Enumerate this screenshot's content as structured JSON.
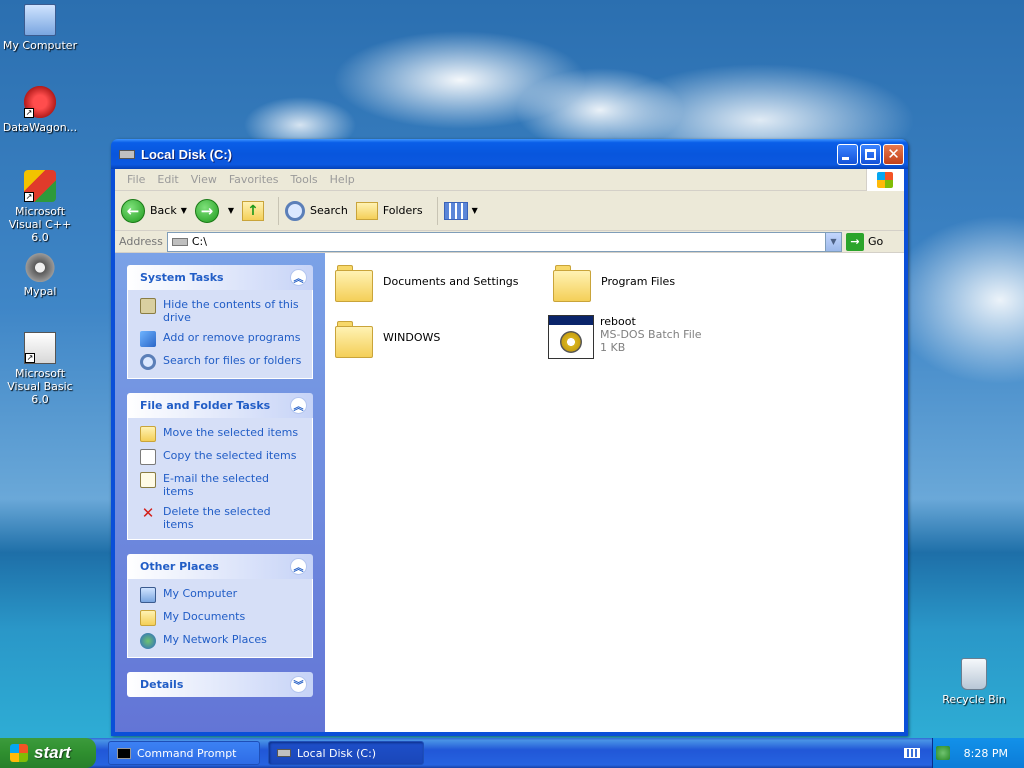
{
  "desktop": {
    "icons": [
      {
        "label": "My Computer"
      },
      {
        "label": "DataWagon..."
      },
      {
        "label": "Microsoft Visual C++ 6.0"
      },
      {
        "label": "Mypal"
      },
      {
        "label": "Microsoft Visual Basic 6.0"
      },
      {
        "label": "Recycle Bin"
      }
    ]
  },
  "window": {
    "title": "Local Disk (C:)",
    "menu": [
      "File",
      "Edit",
      "View",
      "Favorites",
      "Tools",
      "Help"
    ],
    "toolbar": {
      "back": "Back",
      "search": "Search",
      "folders": "Folders"
    },
    "address": {
      "label": "Address",
      "value": "C:\\",
      "go": "Go"
    }
  },
  "sidepane": {
    "system_tasks": {
      "title": "System Tasks",
      "items": [
        "Hide the contents of this drive",
        "Add or remove programs",
        "Search for files or folders"
      ]
    },
    "file_folder_tasks": {
      "title": "File and Folder Tasks",
      "items": [
        "Move the selected items",
        "Copy the selected items",
        "E-mail the selected items",
        "Delete the selected items"
      ]
    },
    "other_places": {
      "title": "Other Places",
      "items": [
        "My Computer",
        "My Documents",
        "My Network Places"
      ]
    },
    "details": {
      "title": "Details"
    }
  },
  "files": [
    {
      "name": "Documents and Settings"
    },
    {
      "name": "Program Files"
    },
    {
      "name": "WINDOWS"
    },
    {
      "name": "reboot",
      "type": "MS-DOS Batch File",
      "size": "1 KB"
    }
  ],
  "taskbar": {
    "start": "start",
    "tasks": [
      "Command Prompt",
      "Local Disk (C:)"
    ],
    "clock": "8:28 PM"
  }
}
